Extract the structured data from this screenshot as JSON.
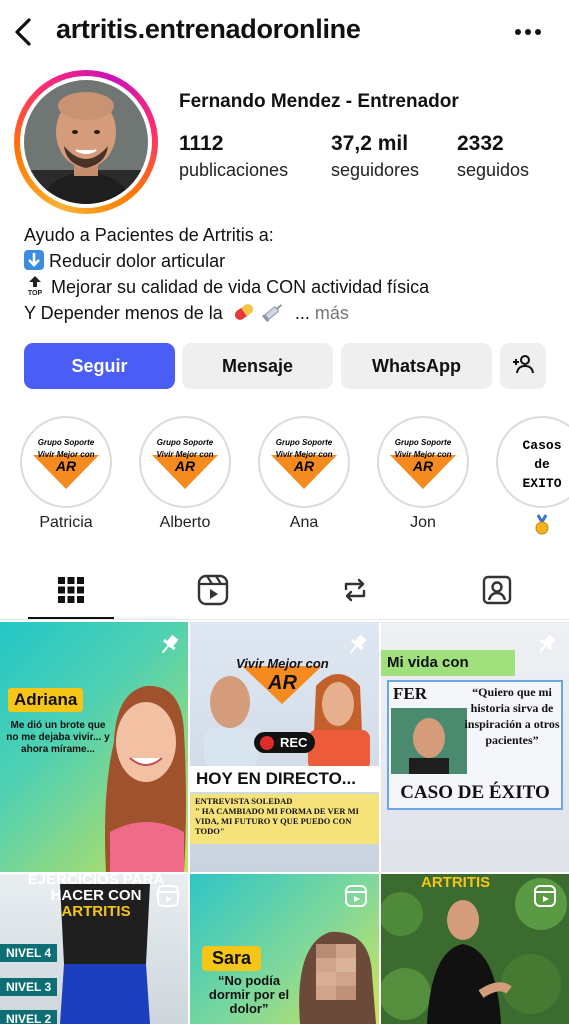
{
  "header": {
    "username": "artritis.entrenadoronline"
  },
  "profile": {
    "full_name": "Fernando Mendez - Entrenador",
    "stats": [
      {
        "value": "1112",
        "label": "publicaciones"
      },
      {
        "value": "37,2 mil",
        "label": "seguidores"
      },
      {
        "value": "2332",
        "label": "seguidos"
      }
    ],
    "bio": {
      "line1": "Ayudo a Pacientes de Artritis a:",
      "line2": "Reducir dolor articular",
      "line3": "Mejorar su calidad de vida CON actividad física",
      "line4": "Y Depender menos de la",
      "line4_tail": " ...",
      "more": "más"
    }
  },
  "buttons": {
    "follow": "Seguir",
    "message": "Mensaje",
    "whatsapp": "WhatsApp"
  },
  "highlights": [
    {
      "label": "Patricia",
      "badge_l1": "Grupo Soporte",
      "badge_l2": "Vivir Mejor con",
      "badge_l3": "AR"
    },
    {
      "label": "Alberto",
      "badge_l1": "Grupo Soporte",
      "badge_l2": "Vivir Mejor con",
      "badge_l3": "AR"
    },
    {
      "label": "Ana",
      "badge_l1": "Grupo Soporte",
      "badge_l2": "Vivir Mejor con",
      "badge_l3": "AR"
    },
    {
      "label": "Jon",
      "badge_l1": "Grupo Soporte",
      "badge_l2": "Vivir Mejor con",
      "badge_l3": "AR"
    },
    {
      "label": "",
      "text_l1": "Casos",
      "text_l2": "de",
      "text_l3": "EXITO"
    }
  ],
  "tabs": [
    "grid-icon",
    "reels-icon",
    "repost-icon",
    "tagged-icon"
  ],
  "posts": {
    "p1": {
      "name": "Adriana",
      "caption": "Me dió un brote que no me dejaba vivir... y ahora mírame..."
    },
    "p2": {
      "banner_l1": "Vivir Mejor con",
      "banner_l2": "AR",
      "rec": "REC",
      "live": "HOY EN DIRECTO...",
      "quote_head": "ENTREVISTA SOLEDAD",
      "quote": "\" HA CAMBIADO MI FORMA DE VER MI VIDA, MI FUTURO Y QUE PUEDO CON TODO\""
    },
    "p3": {
      "title": "Mi vida con Artritis",
      "name": "FER",
      "quote": "“Quiero que mi historia sirva de inspiración a otros pacientes”",
      "footer": "CASO DE ÉXITO"
    },
    "p4": {
      "title_l1": "EJERCICIOS PARA",
      "title_l2": "HACER CON",
      "title_l3": "ARTRITIS",
      "levels": [
        "NIVEL 4",
        "NIVEL 3",
        "NIVEL 2"
      ]
    },
    "p5": {
      "name": "Sara",
      "quote": "“No podía dormir por el dolor”"
    },
    "p6": {
      "title": "ARTRITIS"
    }
  },
  "colors": {
    "follow": "#4a5ef5",
    "ring_start": "#f9b233",
    "ring_end": "#c913b9",
    "badge_orange": "#f58a1f"
  }
}
